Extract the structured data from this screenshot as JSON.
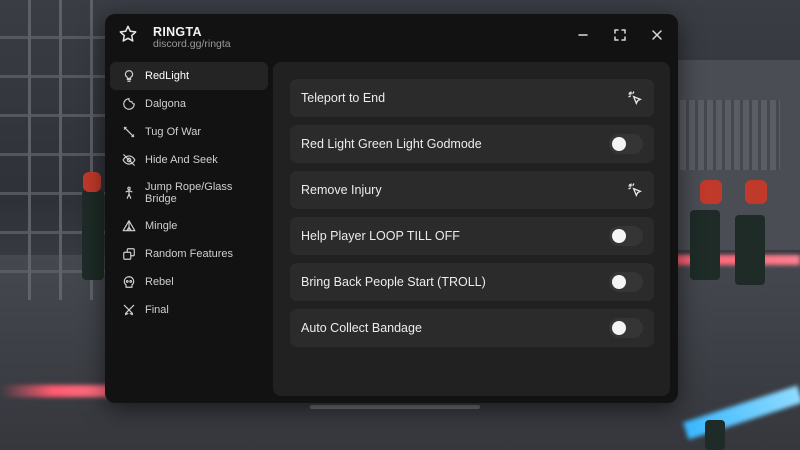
{
  "window": {
    "title": "RINGTA",
    "subtitle": "discord.gg/ringta",
    "icons": {
      "app": "star-icon",
      "minimize": "minimize-icon",
      "maximize": "maximize-icon",
      "close": "close-icon"
    }
  },
  "sidebar": {
    "items": [
      {
        "label": "RedLight",
        "icon": "lightbulb-icon",
        "active": true
      },
      {
        "label": "Dalgona",
        "icon": "cookie-icon",
        "active": false
      },
      {
        "label": "Tug Of War",
        "icon": "rope-icon",
        "active": false
      },
      {
        "label": "Hide And Seek",
        "icon": "eye-off-icon",
        "active": false
      },
      {
        "label": "Jump Rope/Glass Bridge",
        "icon": "person-jump-icon",
        "active": false
      },
      {
        "label": "Mingle",
        "icon": "tent-icon",
        "active": false
      },
      {
        "label": "Random Features",
        "icon": "dice-icon",
        "active": false
      },
      {
        "label": "Rebel",
        "icon": "skull-icon",
        "active": false
      },
      {
        "label": "Final",
        "icon": "swords-icon",
        "active": false
      }
    ]
  },
  "main": {
    "rows": [
      {
        "label": "Teleport to End",
        "type": "button",
        "icon": "click-icon"
      },
      {
        "label": "Red Light Green Light Godmode",
        "type": "toggle",
        "value": false
      },
      {
        "label": "Remove Injury",
        "type": "button",
        "icon": "click-icon"
      },
      {
        "label": "Help Player LOOP TILL OFF",
        "type": "toggle",
        "value": false
      },
      {
        "label": "Bring Back People Start (TROLL)",
        "type": "toggle",
        "value": false
      },
      {
        "label": "Auto Collect Bandage",
        "type": "toggle",
        "value": false
      }
    ]
  },
  "colors": {
    "window_bg": "#121212",
    "panel_bg": "#212121",
    "row_bg": "#2b2b2b",
    "active_item_bg": "#242424",
    "text_primary": "#ececec",
    "text_secondary": "#9a9a9a"
  }
}
